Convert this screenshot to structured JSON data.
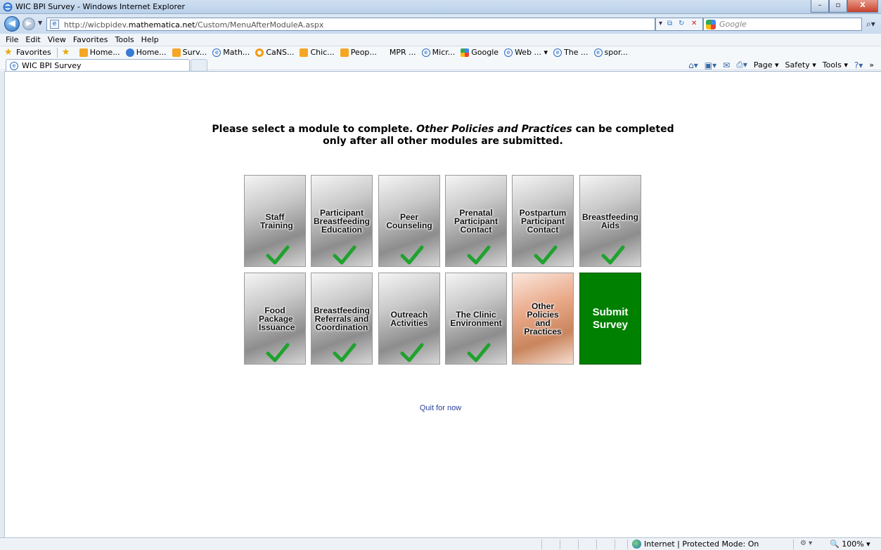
{
  "window": {
    "title": "WIC BPI Survey - Windows Internet Explorer",
    "minimize": "–",
    "maximize": "▫",
    "close": "X"
  },
  "address": {
    "url_prefix": "http://wicbpidev.",
    "url_domain": "mathematica.net",
    "url_path": "/Custom/MenuAfterModuleA.aspx"
  },
  "search": {
    "placeholder": "Google"
  },
  "menu": [
    "File",
    "Edit",
    "View",
    "Favorites",
    "Tools",
    "Help"
  ],
  "favorites": {
    "label": "Favorites",
    "items": [
      {
        "label": "Home...",
        "icon": "orange"
      },
      {
        "label": "Home...",
        "icon": "blue"
      },
      {
        "label": "Surv...",
        "icon": "orange"
      },
      {
        "label": "Math...",
        "icon": "ie"
      },
      {
        "label": "CaNS...",
        "icon": "ring"
      },
      {
        "label": "Chic...",
        "icon": "orange"
      },
      {
        "label": "Peop...",
        "icon": "orange"
      },
      {
        "label": "MPR ...",
        "icon": "none"
      },
      {
        "label": "Micr...",
        "icon": "ie"
      },
      {
        "label": "Google",
        "icon": "gg"
      },
      {
        "label": "Web ... ▾",
        "icon": "ie"
      },
      {
        "label": "The ...",
        "icon": "ie"
      },
      {
        "label": "spor...",
        "icon": "ie"
      }
    ]
  },
  "tab": {
    "label": "WIC BPI Survey"
  },
  "command_bar": {
    "page": "Page ▾",
    "safety": "Safety ▾",
    "tools": "Tools ▾",
    "help": "?▾"
  },
  "page": {
    "heading_line1_a": "Please select a module to complete. ",
    "heading_line1_em": "Other Policies and Practices",
    "heading_line1_b": " can be completed",
    "heading_line2": "only after all other modules are submitted.",
    "quit": "Quit for now"
  },
  "modules_row1": [
    {
      "label": "Staff Training",
      "completed": true
    },
    {
      "label": "Participant Breastfeeding Education",
      "completed": true
    },
    {
      "label": "Peer Counseling",
      "completed": true
    },
    {
      "label": "Prenatal Participant Contact",
      "completed": true
    },
    {
      "label": "Postpartum Participant Contact",
      "completed": true
    },
    {
      "label": "Breastfeeding Aids",
      "completed": true
    }
  ],
  "modules_row2": [
    {
      "label": "Food Package Issuance",
      "completed": true
    },
    {
      "label": "Breastfeeding Referrals and Coordination",
      "completed": true
    },
    {
      "label": "Outreach Activities",
      "completed": true
    },
    {
      "label": "The Clinic Environment",
      "completed": true
    },
    {
      "label": "Other Policies and Practices",
      "completed": false
    },
    {
      "label": "Submit Survey",
      "completed": false
    }
  ],
  "status": {
    "zone": "Internet | Protected Mode: On",
    "zoom": "100%"
  },
  "colors": {
    "submit_green": "#008000",
    "check_green": "#1fa22e",
    "link": "#2a3f9c"
  }
}
